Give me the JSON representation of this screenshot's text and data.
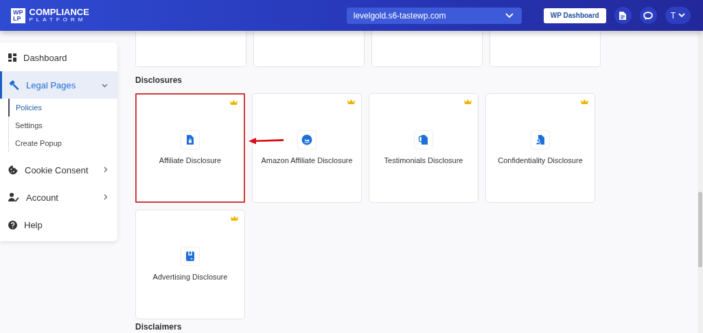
{
  "header": {
    "logo": {
      "mark_top": "WP",
      "mark_bottom": "LP",
      "title": "COMPLIANCE",
      "subtitle": "PLATFORM"
    },
    "site_select": {
      "value": "levelgold.s6-tastewp.com"
    },
    "dashboard_button": "WP Dashboard",
    "user_menu": "T"
  },
  "sidebar": {
    "items": [
      {
        "label": "Dashboard",
        "selected": false
      },
      {
        "label": "Legal Pages",
        "selected": true,
        "expanded": true,
        "children": [
          {
            "label": "Policies",
            "selected": true
          },
          {
            "label": "Settings",
            "selected": false
          },
          {
            "label": "Create Popup",
            "selected": false
          }
        ]
      },
      {
        "label": "Cookie Consent",
        "selected": false,
        "expanded": false
      },
      {
        "label": "Account",
        "selected": false,
        "expanded": false
      },
      {
        "label": "Help",
        "selected": false
      }
    ]
  },
  "sections": [
    {
      "title": "Disclosures",
      "cards": [
        {
          "label": "Affiliate Disclosure",
          "premium": true,
          "highlighted": true
        },
        {
          "label": "Amazon Affiliate Disclosure",
          "premium": true,
          "highlighted": false
        },
        {
          "label": "Testimonials Disclosure",
          "premium": true,
          "highlighted": false
        },
        {
          "label": "Confidentiality Disclosure",
          "premium": true,
          "highlighted": false
        },
        {
          "label": "Advertising Disclosure",
          "premium": true,
          "highlighted": false
        }
      ]
    },
    {
      "title": "Disclaimers"
    }
  ]
}
